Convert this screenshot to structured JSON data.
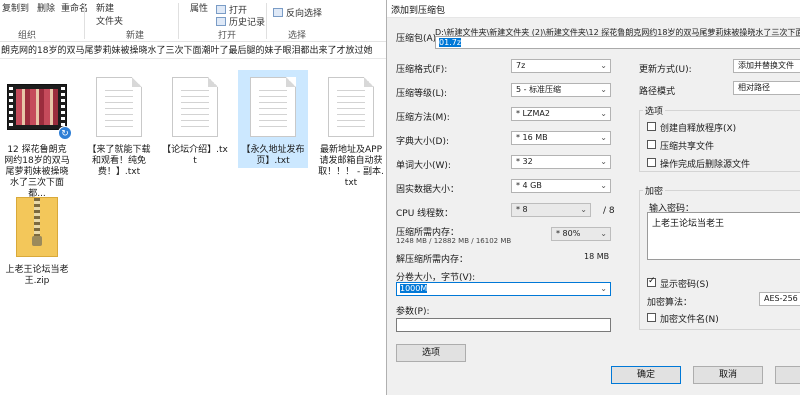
{
  "explorer": {
    "ribbon": {
      "copy_to": "复制到",
      "delete": "删除",
      "rename": "重命名",
      "new_folder_line1": "新建",
      "new_folder_line2": "文件夹",
      "properties": "属性",
      "open": "打开",
      "history": "历史记录",
      "invert_select": "反向选择",
      "groups": [
        "组织",
        "新建",
        "打开",
        "选择"
      ]
    },
    "address": "朗克网的18岁的双马尾萝莉妹被操晓水了三次下面潮叶了最后腿的妹子眼泪都出来了才放过她",
    "files": [
      {
        "name": "12 探花鲁朗克网约18岁的双马尾萝莉妹被操晓水了三次下面都...",
        "type": "video",
        "selected": false
      },
      {
        "name": "【来了就能下载和观看！纯免费！】.txt",
        "type": "txt",
        "selected": false
      },
      {
        "name": "【论坛介绍】.txt",
        "type": "txt",
        "selected": false
      },
      {
        "name": "【永久地址发布页】.txt",
        "type": "txt",
        "selected": true
      },
      {
        "name": "最新地址及APP请发邮箱自动获取！！！ - 副本.txt",
        "type": "txt",
        "selected": false
      },
      {
        "name": "上老王论坛当老王.zip",
        "type": "zip",
        "selected": false
      }
    ]
  },
  "dialog": {
    "title": "添加到压缩包",
    "archive_label": "压缩包(A):",
    "archive_path": "D:\\新建文件夹\\新建文件夹 (2)\\新建文件夹\\12 探花鲁朗克网约18岁的双马尾萝莉妹被操晓水了三次下面",
    "archive_name": "01.7z",
    "format_label": "压缩格式(F):",
    "format_value": "7z",
    "level_label": "压缩等级(L):",
    "level_value": "5 - 标准压缩",
    "method_label": "压缩方法(M):",
    "method_value": "* LZMA2",
    "dict_label": "字典大小(D):",
    "dict_value": "* 16 MB",
    "word_label": "单词大小(W):",
    "word_value": "* 32",
    "solid_label": "固实数据大小：",
    "solid_value": "* 4 GB",
    "cpu_label": "CPU 线程数：",
    "cpu_value": "* 8",
    "cpu_total": "/ 8",
    "mem_label": "压缩所需内存：",
    "mem_detail": "1248 MB / 12882 MB / 16102 MB",
    "mem_pct": "* 80%",
    "decomp_label": "解压缩所需内存：",
    "decomp_value": "18 MB",
    "split_label": "分卷大小，字节(V):",
    "split_value": "1000M",
    "params_label": "参数(P):",
    "params_value": "",
    "options_button": "选项",
    "update_label": "更新方式(U):",
    "update_value": "添加并替换文件",
    "path_label": "路径模式",
    "path_value": "相对路径",
    "options_group": "选项",
    "opt_sfx": "创建自释放程序(X)",
    "opt_shared": "压缩共享文件",
    "opt_delete": "操作完成后删除源文件",
    "encrypt_group": "加密",
    "password_label": "输入密码：",
    "password_value": "上老王论坛当老王",
    "show_password": "显示密码(S)",
    "enc_method_label": "加密算法：",
    "enc_method_value": "AES-256",
    "enc_names": "加密文件名(N)",
    "ok": "确定",
    "cancel": "取消"
  }
}
